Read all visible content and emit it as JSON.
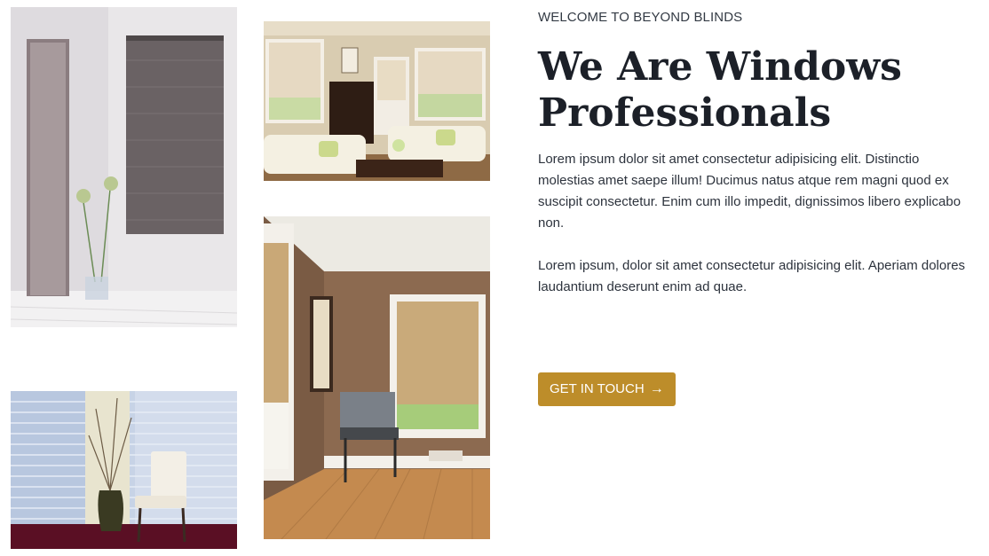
{
  "hero": {
    "eyebrow": "WELCOME TO BEYOND BLINDS",
    "title": "We Are Windows Professionals",
    "paragraphs": [
      "Lorem ipsum dolor sit amet consectetur adipisicing elit. Distinctio molestias amet saepe illum! Ducimus natus atque rem magni quod ex suscipit consectetur. Enim cum illo impedit, dignissimos libero explicabo non.",
      "Lorem ipsum, dolor sit amet consectetur adipisicing elit. Aperiam dolores laudantium deserunt enim ad quae."
    ],
    "cta_label": "GET IN TOUCH",
    "cta_icon": "arrow-right-icon"
  },
  "gallery": [
    {
      "name": "photo-grey-venetian-blinds"
    },
    {
      "name": "photo-living-room-cellular-shades"
    },
    {
      "name": "photo-brown-room-woven-shades"
    },
    {
      "name": "photo-sheer-shades-chair"
    }
  ],
  "colors": {
    "accent": "#bd8d2a",
    "heading": "#1c2028",
    "body_text": "#2d333d",
    "background": "#ffffff"
  }
}
